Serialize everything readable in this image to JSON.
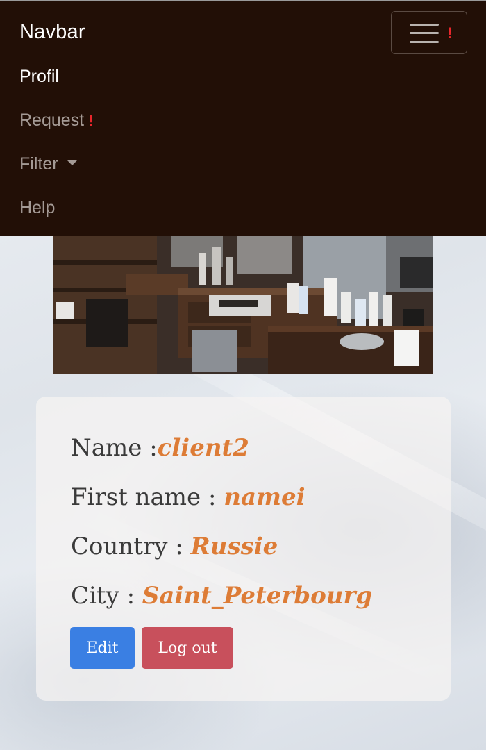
{
  "navbar": {
    "brand": "Navbar",
    "toggler_alert": "!",
    "items": [
      {
        "label": "Profil",
        "active": true
      },
      {
        "label": "Request",
        "alert": "!"
      },
      {
        "label": "Filter",
        "dropdown": true
      },
      {
        "label": "Help"
      }
    ]
  },
  "photo": {
    "subject": "barber shop interior"
  },
  "profile": {
    "name_label": "Name :",
    "name_value": "client2",
    "first_name_label": "First name : ",
    "first_name_value": "namei",
    "country_label": "Country : ",
    "country_value": "Russie",
    "city_label": "City : ",
    "city_value": "Saint_Peterbourg"
  },
  "buttons": {
    "edit": "Edit",
    "logout": "Log out"
  },
  "colors": {
    "navbar_bg": "#220f06",
    "value_accent": "#dd7c36",
    "edit_button": "#3a7fe3",
    "logout_button": "#c8505c",
    "alert": "#e8262b"
  }
}
